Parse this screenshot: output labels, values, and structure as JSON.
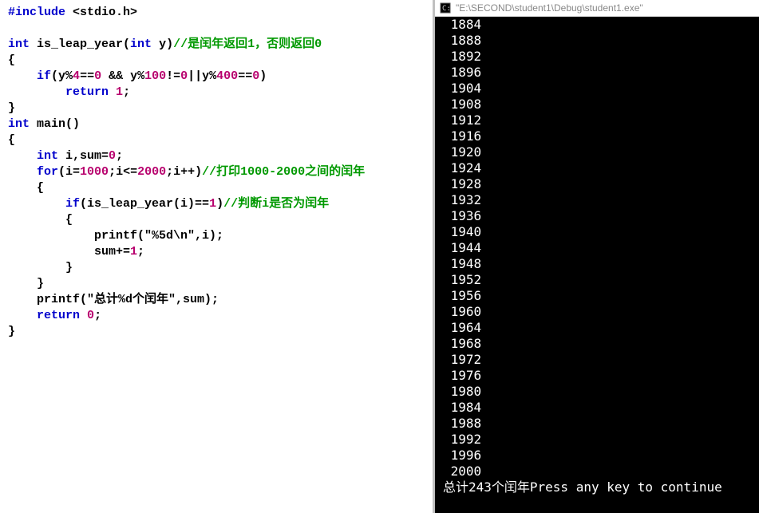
{
  "editor": {
    "tokens": [
      [
        {
          "t": "#include",
          "c": "pp"
        },
        {
          "t": " <stdio.h>",
          "c": "id"
        }
      ],
      [],
      [
        {
          "t": "int",
          "c": "kw"
        },
        {
          "t": " is_leap_year(",
          "c": "id"
        },
        {
          "t": "int",
          "c": "kw"
        },
        {
          "t": " y)",
          "c": "id"
        },
        {
          "t": "//是闰年返回1，否则返回0",
          "c": "cm"
        }
      ],
      [
        {
          "t": "{",
          "c": "op"
        }
      ],
      [
        {
          "t": "    ",
          "c": "id"
        },
        {
          "t": "if",
          "c": "kw"
        },
        {
          "t": "(y%",
          "c": "id"
        },
        {
          "t": "4",
          "c": "num"
        },
        {
          "t": "==",
          "c": "op"
        },
        {
          "t": "0",
          "c": "num"
        },
        {
          "t": " && y%",
          "c": "id"
        },
        {
          "t": "100",
          "c": "num"
        },
        {
          "t": "!=",
          "c": "op"
        },
        {
          "t": "0",
          "c": "num"
        },
        {
          "t": "||y%",
          "c": "id"
        },
        {
          "t": "400",
          "c": "num"
        },
        {
          "t": "==",
          "c": "op"
        },
        {
          "t": "0",
          "c": "num"
        },
        {
          "t": ")",
          "c": "op"
        }
      ],
      [
        {
          "t": "        ",
          "c": "id"
        },
        {
          "t": "return",
          "c": "kw"
        },
        {
          "t": " ",
          "c": "id"
        },
        {
          "t": "1",
          "c": "num"
        },
        {
          "t": ";",
          "c": "op"
        }
      ],
      [
        {
          "t": "}",
          "c": "op"
        }
      ],
      [
        {
          "t": "int",
          "c": "kw"
        },
        {
          "t": " main()",
          "c": "id"
        }
      ],
      [
        {
          "t": "{",
          "c": "op"
        }
      ],
      [
        {
          "t": "    ",
          "c": "id"
        },
        {
          "t": "int",
          "c": "kw"
        },
        {
          "t": " i,sum=",
          "c": "id"
        },
        {
          "t": "0",
          "c": "num"
        },
        {
          "t": ";",
          "c": "op"
        }
      ],
      [
        {
          "t": "    ",
          "c": "id"
        },
        {
          "t": "for",
          "c": "kw"
        },
        {
          "t": "(i=",
          "c": "id"
        },
        {
          "t": "1000",
          "c": "num"
        },
        {
          "t": ";i<=",
          "c": "id"
        },
        {
          "t": "2000",
          "c": "num"
        },
        {
          "t": ";i++)",
          "c": "id"
        },
        {
          "t": "//打印1000-2000之间的闰年",
          "c": "cm"
        }
      ],
      [
        {
          "t": "    {",
          "c": "op"
        }
      ],
      [
        {
          "t": "        ",
          "c": "id"
        },
        {
          "t": "if",
          "c": "kw"
        },
        {
          "t": "(is_leap_year(i)==",
          "c": "id"
        },
        {
          "t": "1",
          "c": "num"
        },
        {
          "t": ")",
          "c": "op"
        },
        {
          "t": "//判断i是否为闰年",
          "c": "cm"
        }
      ],
      [
        {
          "t": "        {",
          "c": "op"
        }
      ],
      [
        {
          "t": "            printf(",
          "c": "id"
        },
        {
          "t": "\"%5d\\n\"",
          "c": "str"
        },
        {
          "t": ",i);",
          "c": "id"
        }
      ],
      [
        {
          "t": "            sum+=",
          "c": "id"
        },
        {
          "t": "1",
          "c": "num"
        },
        {
          "t": ";",
          "c": "op"
        }
      ],
      [
        {
          "t": "        }",
          "c": "op"
        }
      ],
      [
        {
          "t": "    }",
          "c": "op"
        }
      ],
      [
        {
          "t": "    printf(",
          "c": "id"
        },
        {
          "t": "\"总计%d个闰年\"",
          "c": "str"
        },
        {
          "t": ",sum);",
          "c": "id"
        }
      ],
      [
        {
          "t": "    ",
          "c": "id"
        },
        {
          "t": "return",
          "c": "kw"
        },
        {
          "t": " ",
          "c": "id"
        },
        {
          "t": "0",
          "c": "num"
        },
        {
          "t": ";",
          "c": "op"
        }
      ],
      [
        {
          "t": "}",
          "c": "op"
        }
      ]
    ]
  },
  "console": {
    "title": "\"E:\\SECOND\\student1\\Debug\\student1.exe\"",
    "lines": [
      " 1884",
      " 1888",
      " 1892",
      " 1896",
      " 1904",
      " 1908",
      " 1912",
      " 1916",
      " 1920",
      " 1924",
      " 1928",
      " 1932",
      " 1936",
      " 1940",
      " 1944",
      " 1948",
      " 1952",
      " 1956",
      " 1960",
      " 1964",
      " 1968",
      " 1972",
      " 1976",
      " 1980",
      " 1984",
      " 1988",
      " 1992",
      " 1996",
      " 2000"
    ],
    "bottom": "总计243个闰年Press any key to continue"
  }
}
